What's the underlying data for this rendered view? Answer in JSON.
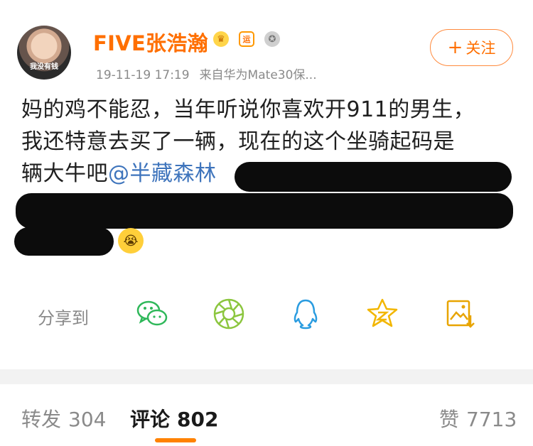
{
  "post": {
    "avatar_caption": "我没有钱",
    "user_name": "FIVE张浩瀚",
    "badges": {
      "vip_icon": "crown-vip-icon",
      "yun_text": "运",
      "medal_icon": "medal-icon"
    },
    "timestamp": "19-11-19 17:19",
    "source": "来自华为Mate30保...",
    "follow_plus": "+",
    "follow_label": "关注",
    "content_line1": "妈的鸡不能忍，当年听说你喜欢开911的男生，",
    "content_line2": "我还特意去买了一辆，现在的这个坐骑起码是",
    "content_line3_prefix": "辆大牛吧",
    "mention": "@半藏森林",
    "emoji": "crying-face-icon"
  },
  "share": {
    "label": "分享到",
    "icons": [
      "wechat-icon",
      "moments-icon",
      "qq-icon",
      "qzone-icon",
      "save-image-icon"
    ]
  },
  "tabs": {
    "repost_label": "转发",
    "repost_count": "304",
    "comment_label": "评论",
    "comment_count": "802",
    "like_label": "赞",
    "like_count": "7713"
  },
  "colors": {
    "accent": "#ff6f00",
    "mention": "#3e74bc",
    "wechat": "#2fb85a",
    "qq": "#2a9ce0",
    "qzone": "#f2b600",
    "tab_underline": "#ff8200"
  }
}
